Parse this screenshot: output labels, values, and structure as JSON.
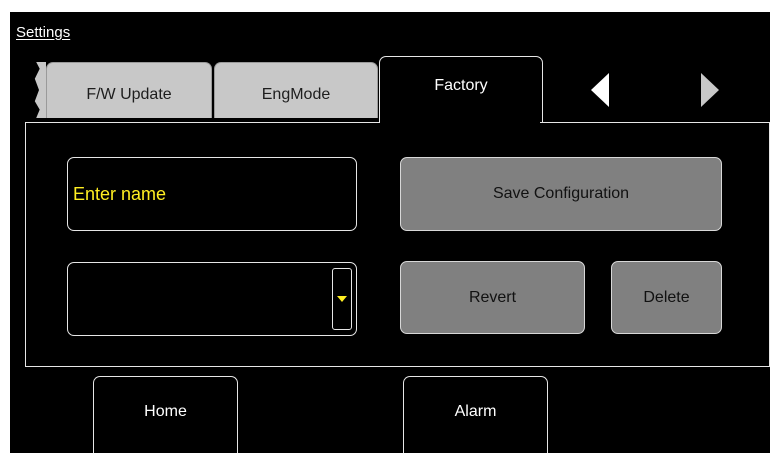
{
  "screen": {
    "title": "Settings"
  },
  "tabs": [
    {
      "label": "F/W Update",
      "active": false
    },
    {
      "label": "EngMode",
      "active": false
    },
    {
      "label": "Factory",
      "active": true
    }
  ],
  "tab_nav": {
    "prev_icon": "left-triangle-icon",
    "next_icon": "right-triangle-icon"
  },
  "form": {
    "name_field": {
      "value": "Enter name",
      "color": "#ffee22"
    },
    "config_select": {
      "selected": "",
      "arrow_icon": "dropdown-arrow-icon",
      "arrow_color": "#ffee22"
    },
    "save_label": "Save Configuration",
    "revert_label": "Revert",
    "delete_label": "Delete"
  },
  "bottom_nav": {
    "home_label": "Home",
    "alarm_label": "Alarm"
  },
  "colors": {
    "background": "#000000",
    "inactive_tab": "#c8c8c8",
    "button_gray": "#808080",
    "border": "#e6e6e6",
    "accent_text": "#ffee22"
  }
}
